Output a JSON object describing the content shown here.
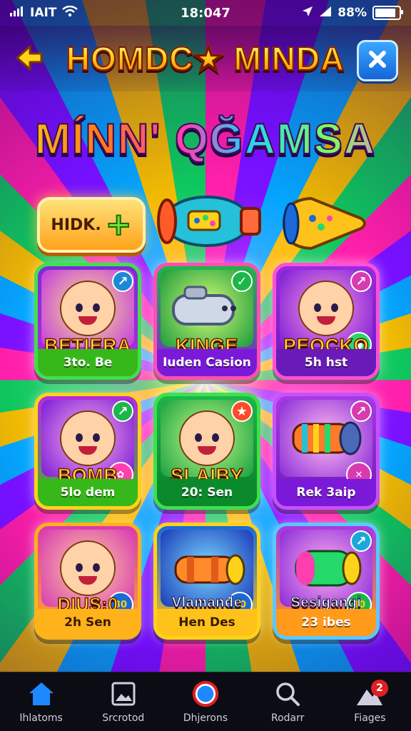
{
  "status": {
    "carrier": "IAIT",
    "time": "18:047",
    "battery": "88%"
  },
  "header": {
    "title": "HOMDC★ MINDA"
  },
  "subtitle": "MÍNN' QĞAMSA",
  "mini_button": {
    "label": "HIDK.",
    "plus": "+"
  },
  "tiles": [
    {
      "name": "BETIERA",
      "sub": "3to. Be"
    },
    {
      "name": "KINGE",
      "sub": "Iuden Casion"
    },
    {
      "name": "PEOCKO",
      "sub": "5h hst"
    },
    {
      "name": "BOMB",
      "sub": "5lo dem"
    },
    {
      "name": "SLAIBY",
      "sub": "20: Sen"
    },
    {
      "name": "",
      "sub": "Rek 3aip"
    },
    {
      "name": "DIUS:0",
      "sub": "2h Sen",
      "badge": "30"
    },
    {
      "name": "Vlamande",
      "sub": "Hen Des",
      "badge": "30"
    },
    {
      "name": "Sesigangi",
      "sub": "23 ibes",
      "badge": "30"
    }
  ],
  "nav": [
    {
      "label": "Ihlatoms"
    },
    {
      "label": "Srcrotod"
    },
    {
      "label": "Dhjerons"
    },
    {
      "label": "Rodarr"
    },
    {
      "label": "Fiages",
      "badge": "2"
    }
  ],
  "colors": {
    "accent_yellow": "#ffd21a",
    "accent_pink": "#ff3fb0",
    "accent_blue": "#19b6ff"
  }
}
